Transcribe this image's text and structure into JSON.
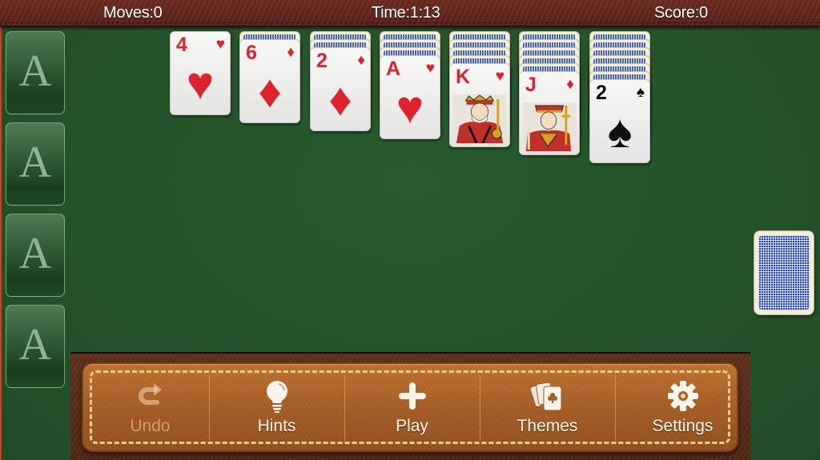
{
  "status": {
    "moves_label": "Moves:0",
    "time_label": "Time:1:13",
    "score_label": "Score:0"
  },
  "foundations": [
    {
      "label": "A"
    },
    {
      "label": "A"
    },
    {
      "label": "A"
    },
    {
      "label": "A"
    }
  ],
  "tableau": [
    {
      "face_down": 0,
      "top_card": {
        "rank": "4",
        "suit": "♥",
        "suit_name": "hearts",
        "color": "red"
      }
    },
    {
      "face_down": 1,
      "top_card": {
        "rank": "6",
        "suit": "♦",
        "suit_name": "diamonds",
        "color": "red"
      }
    },
    {
      "face_down": 2,
      "top_card": {
        "rank": "2",
        "suit": "♦",
        "suit_name": "diamonds",
        "color": "red"
      }
    },
    {
      "face_down": 3,
      "top_card": {
        "rank": "A",
        "suit": "♥",
        "suit_name": "hearts",
        "color": "red"
      }
    },
    {
      "face_down": 4,
      "top_card": {
        "rank": "K",
        "suit": "♥",
        "suit_name": "hearts",
        "color": "red",
        "face": "king"
      }
    },
    {
      "face_down": 5,
      "top_card": {
        "rank": "J",
        "suit": "♦",
        "suit_name": "diamonds",
        "color": "red",
        "face": "jack"
      }
    },
    {
      "face_down": 6,
      "top_card": {
        "rank": "2",
        "suit": "♠",
        "suit_name": "spades",
        "color": "black"
      }
    }
  ],
  "stock": {
    "state": "face-down"
  },
  "toolbar": {
    "undo": {
      "label": "Undo",
      "icon": "undo-icon",
      "enabled": false
    },
    "hints": {
      "label": "Hints",
      "icon": "lightbulb-icon",
      "enabled": true
    },
    "play": {
      "label": "Play",
      "icon": "plus-icon",
      "enabled": true
    },
    "themes": {
      "label": "Themes",
      "icon": "cards-icon",
      "enabled": true
    },
    "settings": {
      "label": "Settings",
      "icon": "gear-icon",
      "enabled": true
    }
  },
  "colors": {
    "felt": "#24522a",
    "card_red": "#e0222c",
    "card_back_blue": "#1f3fd0",
    "leather": "#a85d24",
    "stitch": "#f3cf8d"
  }
}
